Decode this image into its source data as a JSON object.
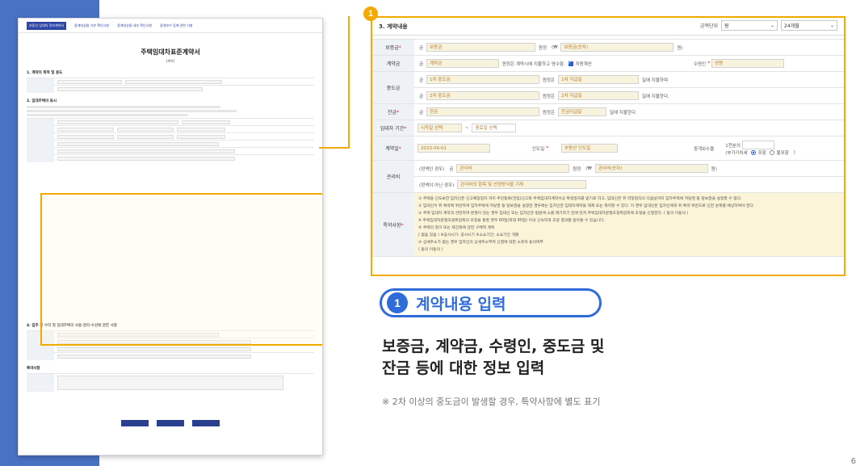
{
  "badge_number": "1",
  "thumbnail": {
    "nav": [
      "부동산 임대차 전자계약서",
      "중개대상물 기본 확인사항",
      "중개대상물 세부 확인사항",
      "중개보수 등에 관한 사항"
    ],
    "doc_title": "주택임대차표준계약서",
    "doc_subtitle": "[계약]",
    "sections": [
      "1. 계약의 목적 및 용도",
      "2. 임대주택의 표시",
      "3. 계약내용",
      "4. 입주 전 수리 및 임대주택의 사용·관리·수선에 관한 사항",
      "특약사항"
    ]
  },
  "zoom": {
    "section_title": "3. 계약내용",
    "unit_label": "금액단위",
    "unit_value": "원",
    "months_value": "24개월",
    "rows": {
      "deposit": {
        "label": "보증금",
        "prefix": "금",
        "placeholder": "보증금",
        "suffix1": "원정",
        "paren": "(₩",
        "placeholder2": "보증금(숫자)",
        "close": "원)"
      },
      "contract": {
        "label": "계약금",
        "prefix": "금",
        "placeholder": "계약금",
        "text": "원정은 계약시에 지불하고 영수함.",
        "checkbox": "자동계산",
        "recv_label": "수령인",
        "recv_placeholder": "성명"
      },
      "middle": {
        "label": "중도금",
        "line1_prefix": "금",
        "line1_placeholder": "1차 중도금",
        "line1_mid": "원정은",
        "line1_date": "1차 지급일",
        "line1_tail": "일에 지불하며",
        "line2_prefix": "금",
        "line2_placeholder": "2차 중도금",
        "line2_mid": "원정은",
        "line2_date": "2차 지급일",
        "line2_tail": "일에 지불한다."
      },
      "balance": {
        "label": "잔금",
        "prefix": "금",
        "placeholder": "잔금",
        "mid": "원정은",
        "date": "잔금지급일",
        "tail": "일에 지불한다."
      },
      "period": {
        "label": "임대차 기간",
        "start": "시작일 선택",
        "dash": "~",
        "end": "종료일 선택"
      },
      "contract_date": {
        "label": "계약일",
        "value": "2023-06-01",
        "deliver_label": "인도일",
        "deliver_placeholder": "부동산 인도일",
        "fee_label": "중개보수율",
        "fee_unit": "1천분의",
        "vat": "(부가가치세",
        "vat_opt1": "포함",
        "vat_opt2": "불포함",
        "vat_close": ")"
      },
      "management": {
        "label": "관리비",
        "line1_paren": "(정액인 경우)",
        "line1_prefix": "금",
        "line1_placeholder": "관리비",
        "line1_mid": "원정",
        "line1_paren2": "(₩",
        "line1_placeholder2": "관리비(숫자)",
        "line1_close": "원)",
        "line2_paren": "(정액이 아닌 경우)",
        "line2_placeholder": "관리비의 항목 및 산정방식을 기재"
      },
      "special": {
        "label": "특약사항",
        "lines": [
          "① 주택을 인도보한 임차인은  신고예정일자  까지 주민등록(전입)신고와 주택임대차계약서상 확정일자를 받기로 하고, 임대인은 위 약정일자의 다음날까지 임차주택에 저당권 등 담보권을 설정할 수 없다.",
          "② 임대인이 위 특약에 위반하여 임차주택에 저당권 등 담보권을 설정한 경우에는 임차인은 임대차계약을 해제 또는 해지할 수 있다. 이 경우 임대인은 임차인에게 위 특약 위반으로 인한 손해를 배상하여야 한다.",
          "③ 주택 임대차 계약과 관련하여 분쟁이 있는 경우 임대인 또는 임차인은 법원에 소를 제기하기 전에 먼저 주택임대차분쟁조정위원회에 조정을 신청한다.  ( 동의  이동의 )",
          "※ 주택임대차분쟁조정위원회의 조정을 통할 경우 60일(최대 90일) 이내 신속하게 조정 결과를 받아볼 수 있습니다.",
          "④ 주택의 철거 또는 재건축에 관한 구체적 계획",
          "( 없음  있음 ) ※공사시기:  공사시기   ※소요기간:  소요기간  개월",
          "⑤ 상세주소가 없는 경우 임차인의 상세주소부여 신청에 대한 소유자 동의여부",
          "( 동의  이동의 )"
        ]
      }
    }
  },
  "caption": {
    "pill_number": "1",
    "pill_title": "계약내용 입력",
    "main_line1": "보증금, 계약금, 수령인, 중도금 및",
    "main_line2": "잔금 등에 대한 정보 입력",
    "note": "※ 2차 이상의 중도금이 발생할 경우, 특약사항에 별도 표기"
  },
  "page_number": "6",
  "colors": {
    "left_band": "#4a72c4",
    "accent_yellow": "#f2a900",
    "accent_blue": "#2f6bd9",
    "required_red": "#e0262e"
  }
}
